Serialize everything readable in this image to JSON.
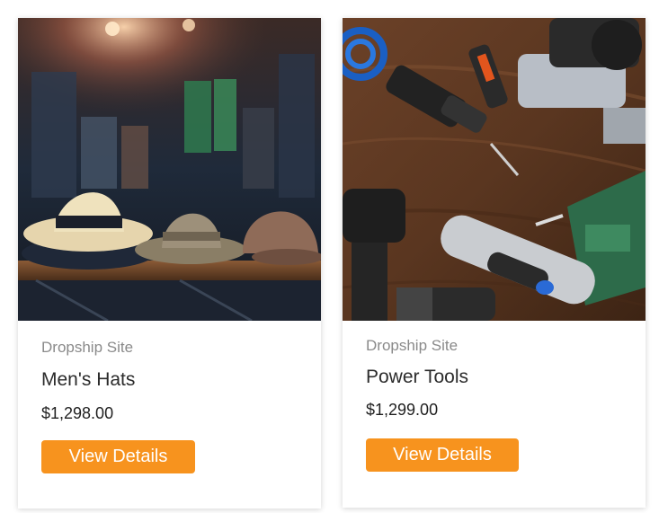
{
  "products": [
    {
      "category": "Dropship Site",
      "title": "Men's Hats",
      "price": "$1,298.00",
      "button_label": "View Details",
      "image_alt": "hats-photo"
    },
    {
      "category": "Dropship Site",
      "title": "Power Tools",
      "price": "$1,299.00",
      "button_label": "View Details",
      "image_alt": "power-tools-photo"
    }
  ],
  "colors": {
    "button_bg": "#f7931e",
    "button_text": "#ffffff",
    "category_text": "#8a8a8a",
    "title_text": "#2b2b2b"
  }
}
